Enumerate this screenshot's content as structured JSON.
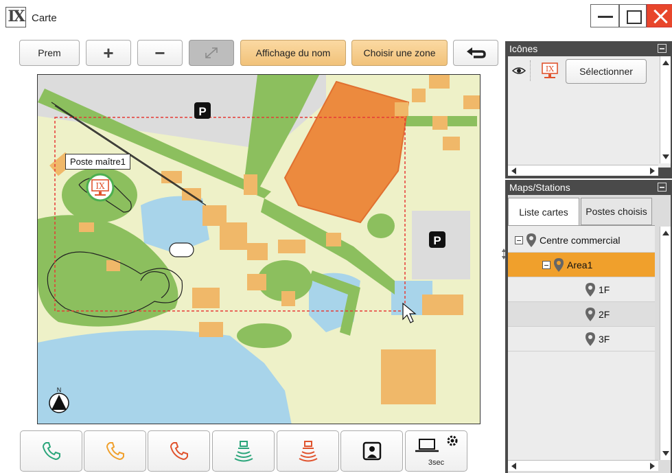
{
  "window": {
    "title": "Carte",
    "logo": "IX"
  },
  "toolbar": {
    "prem": "Prem",
    "zoom_in": "+",
    "zoom_out": "−",
    "show_name": "Affichage du nom",
    "choose_zone": "Choisir une zone"
  },
  "map": {
    "station_label": "Poste maître1",
    "parking": "P",
    "north": "N"
  },
  "bottom_bar": {
    "timer_label": "3sec"
  },
  "icons_panel": {
    "title": "Icônes",
    "select_button": "Sélectionner"
  },
  "maps_panel": {
    "title": "Maps/Stations",
    "tabs": [
      "Liste cartes",
      "Postes choisis"
    ],
    "tree": [
      {
        "label": "Centre commercial",
        "level": 0,
        "expanded": true,
        "selected": false
      },
      {
        "label": "Area1",
        "level": 1,
        "expanded": true,
        "selected": true
      },
      {
        "label": "1F",
        "level": 2,
        "selected": false
      },
      {
        "label": "2F",
        "level": 2,
        "selected": false
      },
      {
        "label": "3F",
        "level": 2,
        "selected": false
      }
    ]
  },
  "colors": {
    "accent_orange": "#f0a02c",
    "button_orange": "#f4c785",
    "panel_dark": "#4a4a4a",
    "call_green": "#2aa57a",
    "call_orange": "#f0a02c",
    "call_red": "#e0532d",
    "selection_red": "#e53935"
  }
}
